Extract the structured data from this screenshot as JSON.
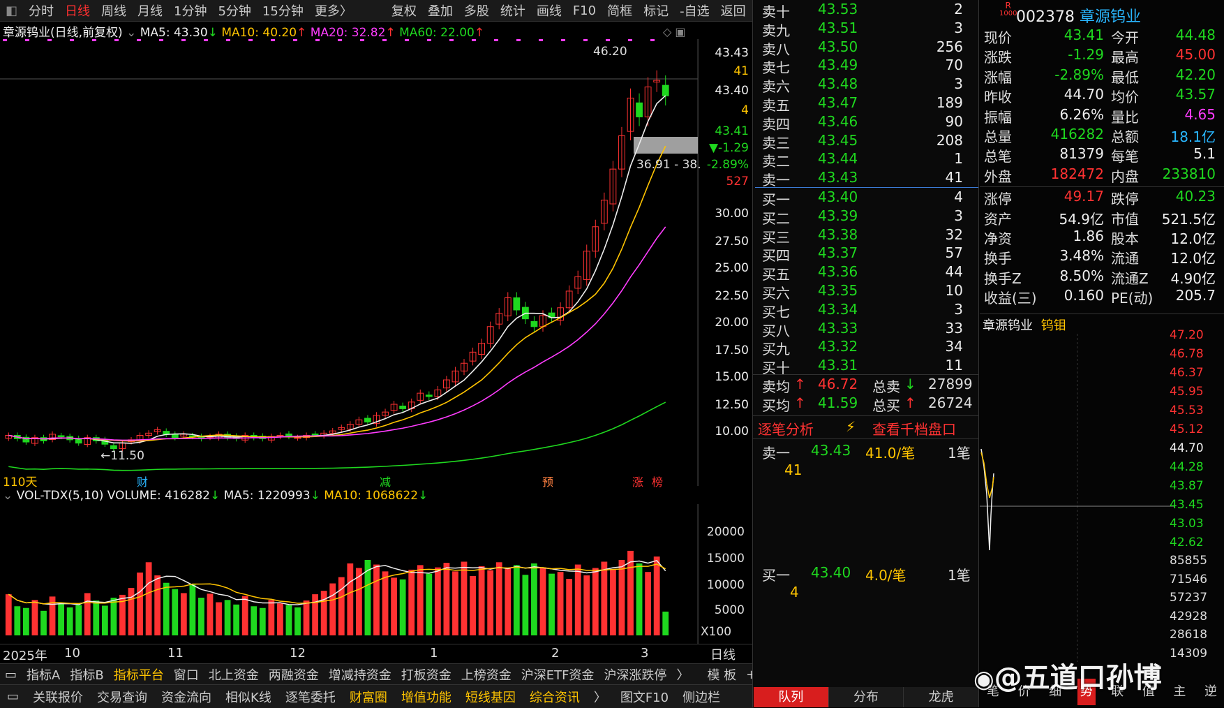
{
  "toolbar": {
    "items": [
      "分时",
      "日线",
      "周线",
      "月线",
      "1分钟",
      "5分钟",
      "15分钟",
      "更多〉",
      "复权",
      "叠加",
      "多股",
      "统计",
      "画线",
      "F10",
      "简框",
      "标记",
      "-自选",
      "返回"
    ]
  },
  "main_chart": {
    "title": "章源钨业(日线,前复权)",
    "ma5": "MA5: 43.30",
    "ma10": "MA10: 40.20",
    "ma20": "MA20: 32.82",
    "ma60": "MA60: 22.00",
    "y_ticks": [
      "43.43",
      "41",
      "43.40",
      "4",
      "43.41",
      "▼-1.29",
      "-2.89%",
      "527",
      "30.00",
      "27.50",
      "25.00",
      "22.50",
      "20.00",
      "17.50",
      "15.00",
      "12.50",
      "10.00"
    ],
    "high_label": "46.20",
    "low_label": "11.50",
    "range_label": "36.91 - 38.",
    "days_label": "110天",
    "markers": [
      "财",
      "减",
      "预",
      "涨",
      "榜"
    ]
  },
  "volume_chart": {
    "title": "VOL-TDX(5,10)",
    "volume": "VOLUME: 416282",
    "ma5": "MA5: 1220993",
    "ma10": "MA10: 1068622",
    "y_ticks": [
      "20000",
      "15000",
      "10000",
      "5000"
    ],
    "unit": "X100",
    "x_labels": [
      "2025年",
      "10",
      "11",
      "12",
      "1",
      "2",
      "3"
    ],
    "period": "日线"
  },
  "orderbook": {
    "asks": [
      {
        "label": "卖十",
        "price": "43.53",
        "vol": "2"
      },
      {
        "label": "卖九",
        "price": "43.51",
        "vol": "3"
      },
      {
        "label": "卖八",
        "price": "43.50",
        "vol": "256"
      },
      {
        "label": "卖七",
        "price": "43.49",
        "vol": "70"
      },
      {
        "label": "卖六",
        "price": "43.48",
        "vol": "3"
      },
      {
        "label": "卖五",
        "price": "43.47",
        "vol": "189"
      },
      {
        "label": "卖四",
        "price": "43.46",
        "vol": "90"
      },
      {
        "label": "卖三",
        "price": "43.45",
        "vol": "208"
      },
      {
        "label": "卖二",
        "price": "43.44",
        "vol": "1"
      },
      {
        "label": "卖一",
        "price": "43.43",
        "vol": "41"
      }
    ],
    "bids": [
      {
        "label": "买一",
        "price": "43.40",
        "vol": "4"
      },
      {
        "label": "买二",
        "price": "43.39",
        "vol": "3"
      },
      {
        "label": "买三",
        "price": "43.38",
        "vol": "32"
      },
      {
        "label": "买四",
        "price": "43.37",
        "vol": "57"
      },
      {
        "label": "买五",
        "price": "43.36",
        "vol": "44"
      },
      {
        "label": "买六",
        "price": "43.35",
        "vol": "10"
      },
      {
        "label": "买七",
        "price": "43.34",
        "vol": "3"
      },
      {
        "label": "买八",
        "price": "43.33",
        "vol": "33"
      },
      {
        "label": "买九",
        "price": "43.32",
        "vol": "34"
      },
      {
        "label": "买十",
        "price": "43.31",
        "vol": "11"
      }
    ],
    "avg_ask_label": "卖均",
    "avg_ask": "46.72",
    "total_ask_label": "总卖",
    "total_ask": "27899",
    "avg_bid_label": "买均",
    "avg_bid": "41.59",
    "total_bid_label": "总买",
    "total_bid": "26724",
    "tick_analysis": "逐笔分析",
    "view_1000": "查看千档盘口",
    "tick1": {
      "label": "卖一",
      "price": "43.43",
      "per": "41.0/笔",
      "count": "1笔",
      "sub": "41"
    },
    "tick2": {
      "label": "买一",
      "price": "43.40",
      "per": "4.0/笔",
      "count": "1笔",
      "sub": "4"
    },
    "tabs": [
      "队列",
      "分布",
      "龙虎"
    ]
  },
  "quote": {
    "badge": "R",
    "badge_sub": "1000",
    "code": "002378",
    "name": "章源钨业",
    "rows": [
      [
        "现价",
        "43.41",
        "今开",
        "44.48"
      ],
      [
        "涨跌",
        "-1.29",
        "最高",
        "45.00"
      ],
      [
        "涨幅",
        "-2.89%",
        "最低",
        "42.20"
      ],
      [
        "昨收",
        "44.70",
        "均价",
        "43.57"
      ],
      [
        "振幅",
        "6.26%",
        "量比",
        "4.65"
      ],
      [
        "总量",
        "416282",
        "总额",
        "18.1亿"
      ],
      [
        "总笔",
        "81379",
        "每笔",
        "5.1"
      ],
      [
        "外盘",
        "182472",
        "内盘",
        "233810"
      ],
      [
        "涨停",
        "49.17",
        "跌停",
        "40.23"
      ],
      [
        "资产",
        "54.9亿",
        "市值",
        "521.5亿"
      ],
      [
        "净资",
        "1.86",
        "股本",
        "12.0亿"
      ],
      [
        "换手",
        "3.48%",
        "流通",
        "12.0亿"
      ],
      [
        "换手Z",
        "8.50%",
        "流通Z",
        "4.90亿"
      ],
      [
        "收益(三)",
        "0.160",
        "PE(动)",
        "205.7"
      ]
    ],
    "mini_title": "章源钨业",
    "mini_tag": "钨钼",
    "mini_prices": [
      "47.20",
      "46.78",
      "46.37",
      "45.95",
      "45.53",
      "45.12",
      "44.70",
      "44.28",
      "43.87",
      "43.45",
      "43.03",
      "42.62"
    ],
    "mini_vols": [
      "85855",
      "71546",
      "57237",
      "42928",
      "28618",
      "14309"
    ],
    "mini_tabs": [
      "笔",
      "价",
      "细",
      "势",
      "联",
      "值",
      "主",
      "逆"
    ]
  },
  "bottom_tabs": [
    "指标A",
    "指标B",
    "指标平台",
    "窗口",
    "北上资金",
    "两融资金",
    "增减持资金",
    "打板资金",
    "上榜资金",
    "沪深ETF资金",
    "沪深涨跌停",
    "〉",
    "模 板",
    "+",
    "−"
  ],
  "bottom_tabs2": [
    "关联报价",
    "交易查询",
    "资金流向",
    "相似K线",
    "逐笔委托",
    "财富圈",
    "增值功能",
    "短线基因",
    "综合资讯",
    "〉",
    "图文F10",
    "侧边栏"
  ],
  "watermark": "@五道口孙博",
  "chart_data": {
    "type": "candlestick",
    "title": "章源钨业(日线,前复权)",
    "ylim": [
      10,
      46.5
    ],
    "close": [
      12.8,
      12.5,
      12.2,
      12.6,
      12.3,
      12.9,
      12.7,
      12.4,
      12.1,
      12.6,
      12.3,
      12.0,
      11.6,
      12.1,
      12.4,
      12.8,
      13.0,
      13.3,
      12.9,
      12.6,
      12.9,
      12.7,
      12.5,
      12.7,
      12.9,
      12.6,
      12.5,
      12.8,
      12.6,
      12.5,
      12.7,
      12.8,
      12.7,
      12.6,
      12.8,
      12.9,
      13.0,
      13.2,
      13.5,
      13.8,
      14.2,
      14.0,
      14.6,
      14.9,
      15.6,
      15.2,
      15.8,
      16.6,
      16.3,
      16.9,
      17.8,
      18.6,
      19.3,
      20.3,
      21.1,
      22.6,
      23.8,
      25.2,
      24.1,
      23.3,
      22.6,
      23.6,
      23.4,
      24.3,
      25.8,
      27.1,
      29.4,
      31.6,
      34.0,
      36.8,
      39.8,
      43.2,
      41.5,
      44.2,
      44.8,
      43.4
    ],
    "volume": [
      7200,
      5100,
      4800,
      6200,
      4300,
      6800,
      5600,
      4900,
      5300,
      7400,
      6100,
      5200,
      6600,
      7100,
      8300,
      11000,
      12800,
      10500,
      9200,
      8100,
      7400,
      8900,
      6600,
      7300,
      5800,
      6200,
      5400,
      6900,
      5100,
      4800,
      6200,
      5600,
      5300,
      4900,
      6100,
      7200,
      7800,
      9100,
      10200,
      12600,
      11800,
      13200,
      12400,
      11200,
      10100,
      9800,
      11500,
      12300,
      10800,
      11900,
      12700,
      11200,
      12900,
      10400,
      12100,
      11400,
      12800,
      11700,
      12300,
      10600,
      12600,
      11900,
      10800,
      11100,
      9900,
      12400,
      10500,
      11800,
      12900,
      11600,
      13200,
      14800,
      12600,
      11100,
      13800,
      4162.82
    ]
  }
}
